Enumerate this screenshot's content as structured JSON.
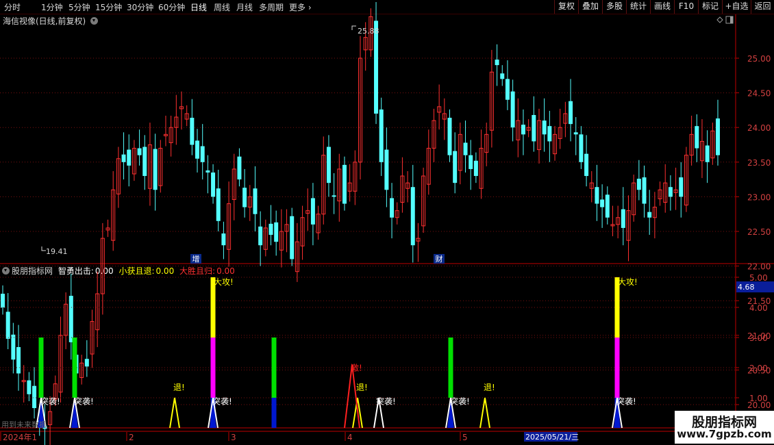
{
  "toolbar": {
    "periods": [
      "分时",
      "1分钟",
      "5分钟",
      "15分钟",
      "30分钟",
      "60分钟",
      "日线",
      "周线",
      "月线",
      "多周期",
      "更多"
    ],
    "active_period": "日线",
    "more_arrow": "›",
    "buttons": [
      "复权",
      "叠加",
      "多股",
      "统计",
      "画线",
      "F10",
      "标记",
      "+自选",
      "返回"
    ]
  },
  "price_panel": {
    "title": "海信视像(日线,前复权)",
    "y_labels": [
      "25.00",
      "24.50",
      "24.00",
      "23.50",
      "23.00",
      "22.50",
      "22.00",
      "21.50",
      "21.00",
      "20.50",
      "20.00"
    ],
    "high_label": "25.88",
    "low_label": "19.41",
    "markers": [
      "增",
      "财"
    ]
  },
  "indicator_panel": {
    "name": "股朋指标网",
    "legend": [
      {
        "label": "智勇出击:",
        "value": "0.00",
        "color": "#ffffff"
      },
      {
        "label": "小获且退:",
        "value": "0.00",
        "color": "#ffff00"
      },
      {
        "label": "大胜且归:",
        "value": "0.00",
        "color": "#ff3030"
      }
    ],
    "y_labels": [
      "5.00",
      "4.00",
      "3.00",
      "2.00",
      "1.00"
    ],
    "current_value": "4.68",
    "signal_labels": {
      "attack": "突袭!",
      "retreat": "退!",
      "big_attack": "大攻!",
      "surge": "激!"
    }
  },
  "time_axis": {
    "labels": [
      "2024年1",
      "2",
      "3",
      "4",
      "5"
    ],
    "cursor_date": "2025/05/21/三",
    "hint": "用到未来数据"
  },
  "watermark": {
    "title": "股朋指标网",
    "url": "www.7gpzb.com"
  },
  "colors": {
    "up": "#ff3030",
    "down": "#54ffff",
    "border": "#c00000",
    "grid": "#7a1010",
    "axis_text": "#d24040"
  }
}
